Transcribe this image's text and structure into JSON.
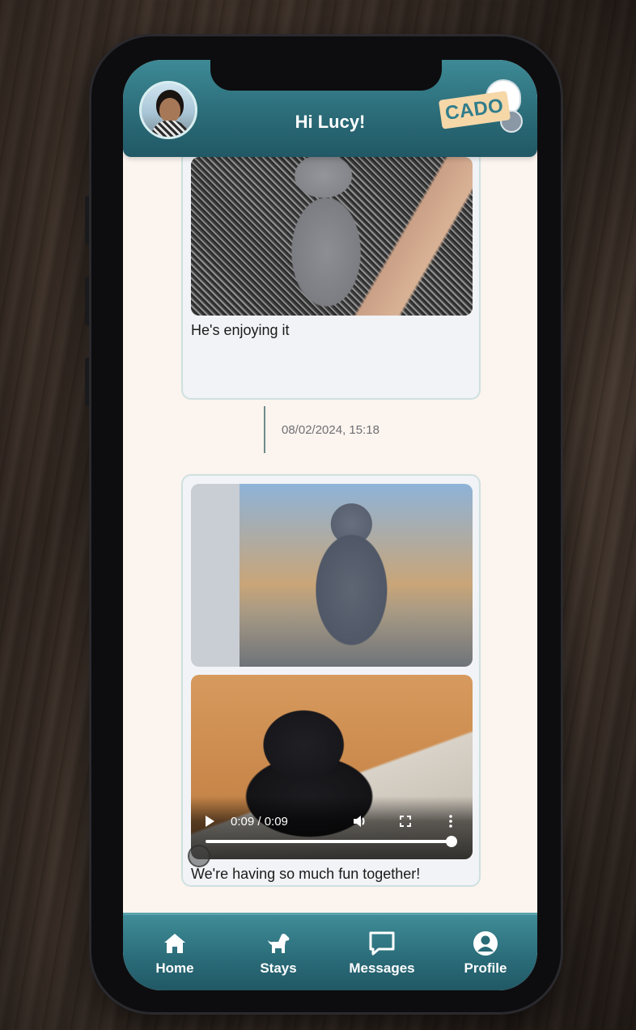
{
  "header": {
    "greeting": "Hi Lucy!",
    "logo_text": "CADO"
  },
  "messages": [
    {
      "media": [
        "cat-belly-photo"
      ],
      "caption": "He's enjoying it"
    },
    {
      "timestamp": "08/02/2024, 15:18",
      "media": [
        "cat-standing-photo",
        "cat-video"
      ],
      "video": {
        "time": "0:09 / 0:09",
        "progress": 1.0
      },
      "caption": "We're having so much fun together!"
    }
  ],
  "bottom_nav": {
    "items": [
      {
        "label": "Home",
        "icon": "home-icon"
      },
      {
        "label": "Stays",
        "icon": "dog-icon"
      },
      {
        "label": "Messages",
        "icon": "message-icon"
      },
      {
        "label": "Profile",
        "icon": "profile-icon"
      }
    ]
  },
  "colors": {
    "header": "#2a6a76",
    "background": "#fbf4ef",
    "bubble": "#f1f3f6",
    "accent": "#3d8a96"
  }
}
